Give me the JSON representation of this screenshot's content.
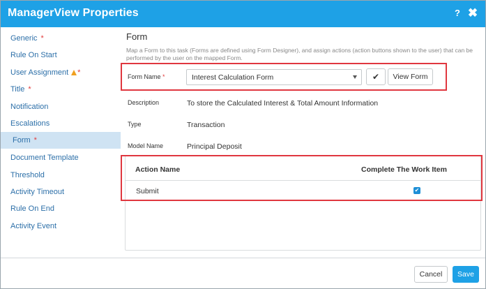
{
  "window": {
    "title": "ManagerView Properties",
    "help_label": "?",
    "close_label": "✖"
  },
  "sidebar": {
    "items": [
      {
        "label": "Generic",
        "required": "*"
      },
      {
        "label": "Rule On Start"
      },
      {
        "label": "User Assignment",
        "required": "*",
        "warning_icon": "warning-triangle-icon"
      },
      {
        "label": "Title",
        "required": "*"
      },
      {
        "label": "Notification"
      },
      {
        "label": "Escalations"
      },
      {
        "label": "Form",
        "required": "*",
        "active": true
      },
      {
        "label": "Document Template"
      },
      {
        "label": "Threshold"
      },
      {
        "label": "Activity Timeout"
      },
      {
        "label": "Rule On End"
      },
      {
        "label": "Activity Event"
      }
    ]
  },
  "main": {
    "title": "Form",
    "description": "Map a Form to this task (Forms are defined using Form Designer), and assign actions (action buttons shown to the user) that can be performed by the user on the mapped Form.",
    "form_name": {
      "label": "Form Name",
      "required": "*",
      "selected_value": "Interest Calculation Form",
      "confirm_icon": "check-icon",
      "view_button": "View Form"
    },
    "details": [
      {
        "label": "Description",
        "value": "To store the Calculated Interest & Total Amount Information"
      },
      {
        "label": "Type",
        "value": "Transaction"
      },
      {
        "label": "Model Name",
        "value": "Principal Deposit"
      }
    ],
    "actions_table": {
      "columns": [
        "Action Name",
        "Complete The Work Item"
      ],
      "rows": [
        {
          "action_name": "Submit",
          "complete_work_item": true
        }
      ]
    }
  },
  "footer": {
    "cancel_label": "Cancel",
    "save_label": "Save"
  },
  "colors": {
    "accent": "#1ea1e6",
    "highlight_border": "#e0373f",
    "active_nav_bg": "#cfe3f3",
    "link_text": "#2c6fa8"
  }
}
